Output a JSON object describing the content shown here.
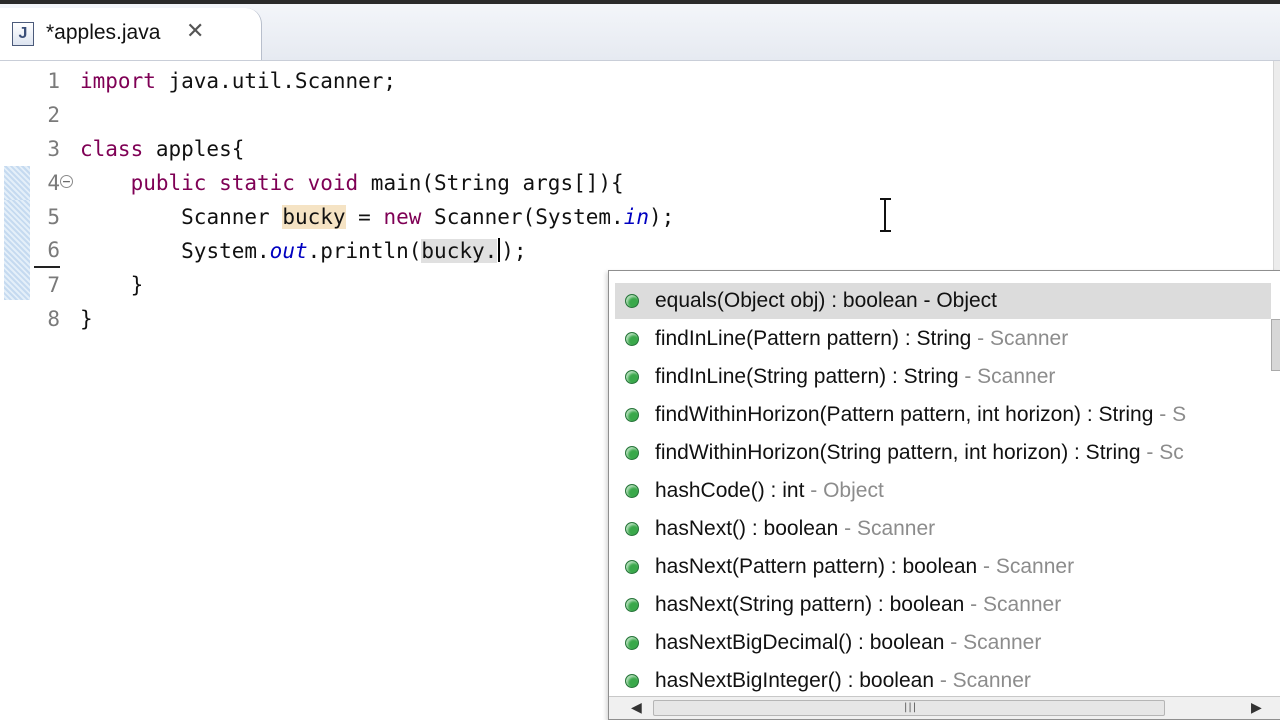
{
  "tab": {
    "file_icon_letter": "J",
    "title": "*apples.java",
    "close_glyph": "✕"
  },
  "editor": {
    "lines": [
      {
        "no": "1"
      },
      {
        "no": "2"
      },
      {
        "no": "3"
      },
      {
        "no": "4"
      },
      {
        "no": "5"
      },
      {
        "no": "6"
      },
      {
        "no": "7"
      },
      {
        "no": "8"
      }
    ],
    "fold_glyph": "−",
    "code": {
      "l1_kw": "import",
      "l1_rest": " java.util.Scanner;",
      "l3_kw": "class",
      "l3_rest": " apples{",
      "l4_kw": "public static void",
      "l4_rest": " main(String args[]){",
      "l5_a": "Scanner ",
      "l5_var": "bucky",
      "l5_b": " = ",
      "l5_kw": "new",
      "l5_c": " Scanner(System.",
      "l5_fld": "in",
      "l5_d": ");",
      "l6_a": "System.",
      "l6_fld": "out",
      "l6_b": ".println(",
      "l6_var": "bucky.",
      "l6_c": ");",
      "l7": "}",
      "l8": "}"
    },
    "colors": {
      "keyword": "#7f0055",
      "field": "#0000c0",
      "occurrence": "#f5e3c4"
    }
  },
  "content_assist": {
    "items": [
      {
        "sig": "equals(Object obj) : boolean - Object",
        "decl": ""
      },
      {
        "sig": "findInLine(Pattern pattern) : String",
        "decl": " - Scanner"
      },
      {
        "sig": "findInLine(String pattern) : String",
        "decl": " - Scanner"
      },
      {
        "sig": "findWithinHorizon(Pattern pattern, int horizon) : String",
        "decl": " - S"
      },
      {
        "sig": "findWithinHorizon(String pattern, int horizon) : String",
        "decl": " - Sc"
      },
      {
        "sig": "hashCode() : int",
        "decl": " - Object"
      },
      {
        "sig": "hasNext() : boolean",
        "decl": " - Scanner"
      },
      {
        "sig": "hasNext(Pattern pattern) : boolean",
        "decl": " - Scanner"
      },
      {
        "sig": "hasNext(String pattern) : boolean",
        "decl": " - Scanner"
      },
      {
        "sig": "hasNextBigDecimal() : boolean",
        "decl": " - Scanner"
      },
      {
        "sig": "hasNextBigInteger() : boolean",
        "decl": " - Scanner"
      }
    ],
    "scroll_left": "◀",
    "scroll_right": "▶",
    "scroll_grip": "|||",
    "method_icon": "public-method-icon",
    "method_icon_color": "#39a84a"
  }
}
